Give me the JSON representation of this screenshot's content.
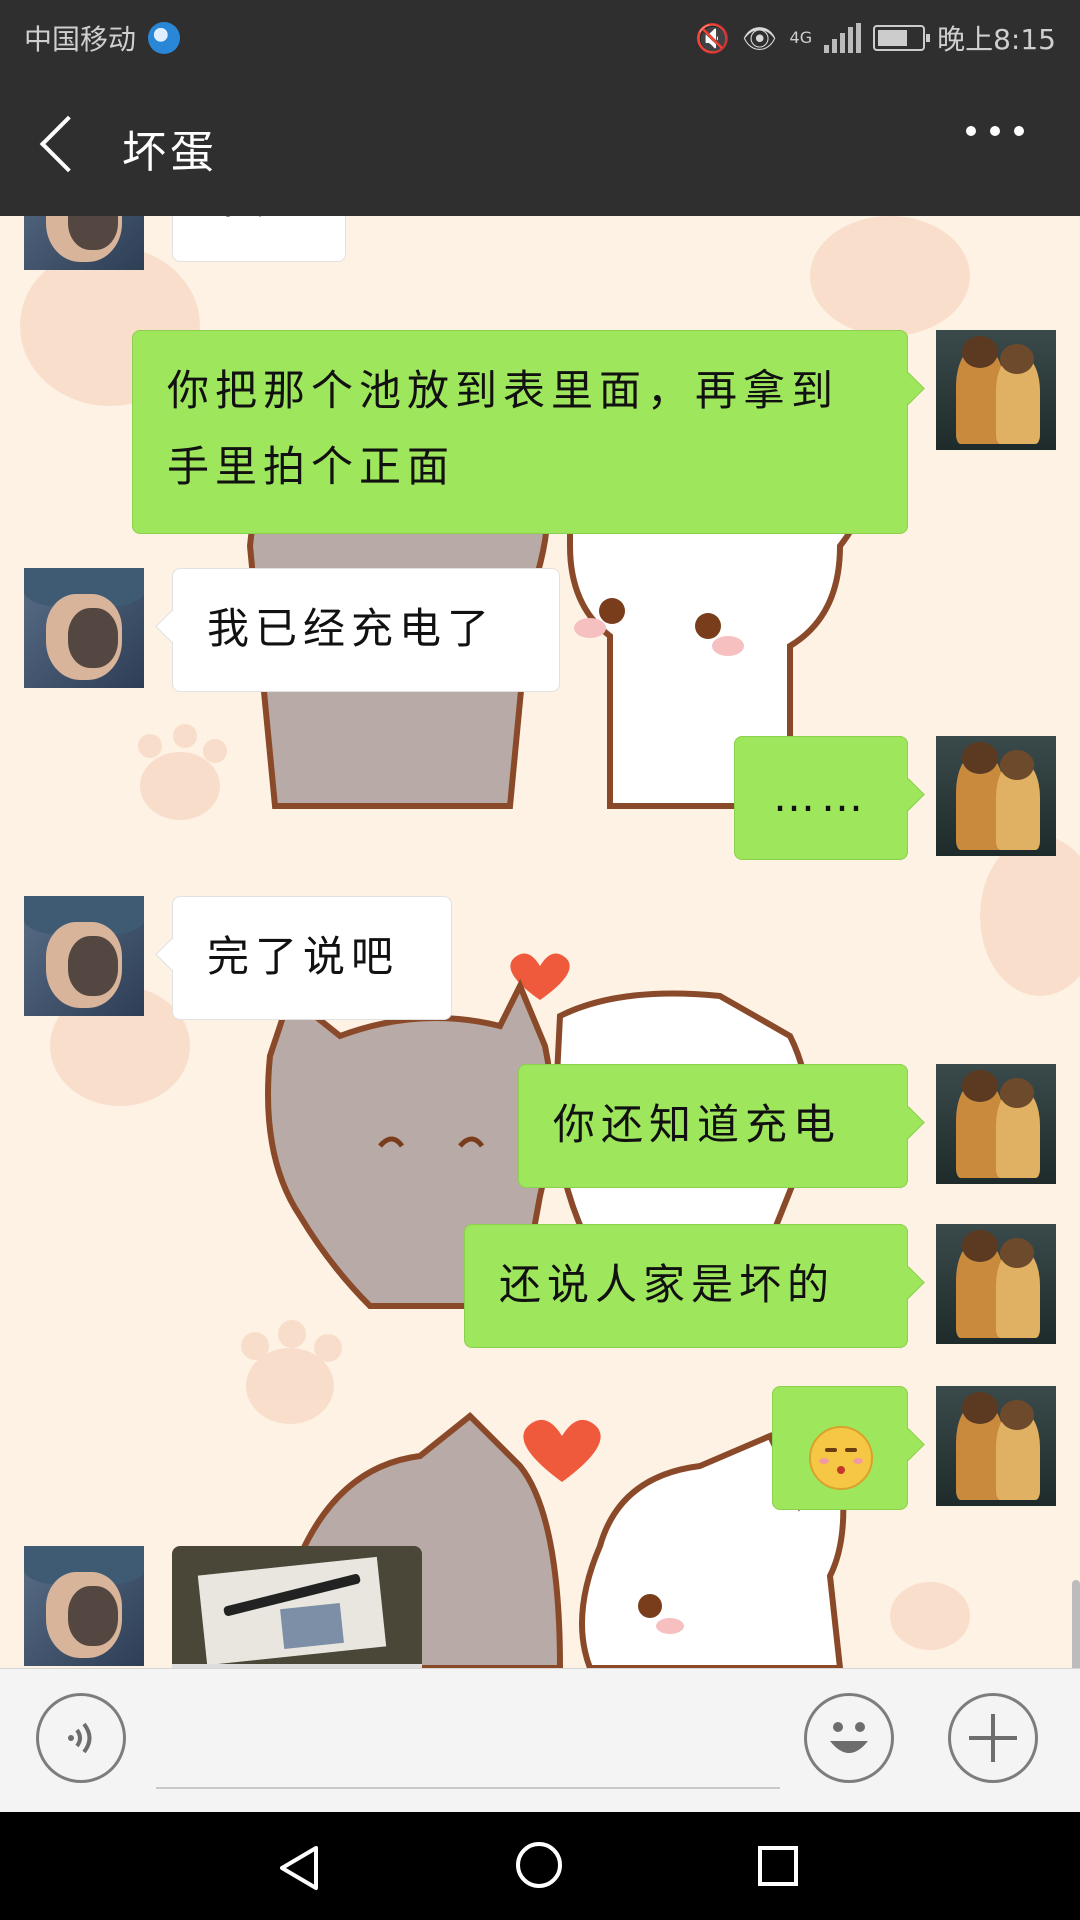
{
  "status_bar": {
    "carrier": "中国移动",
    "network": "4G",
    "time": "晚上8:15",
    "battery_level": 0.6,
    "icons": [
      "mute-icon",
      "eye-icon",
      "signal-icon",
      "battery-icon"
    ]
  },
  "header": {
    "title": "坏蛋"
  },
  "messages": [
    {
      "from": "other",
      "text": "不亮"
    },
    {
      "from": "me",
      "text": "你把那个池放到表里面，再拿到手里拍个正面"
    },
    {
      "from": "other",
      "text": "我已经充电了"
    },
    {
      "from": "me",
      "text": "……"
    },
    {
      "from": "other",
      "text": "完了说吧"
    },
    {
      "from": "me",
      "text": "你还知道充电"
    },
    {
      "from": "me",
      "text": "还说人家是坏的"
    },
    {
      "from": "me",
      "type": "emoji",
      "emoji": "blushing-kiss-emoji"
    },
    {
      "from": "other",
      "type": "photo",
      "photo": "photo-thumbnail"
    }
  ],
  "input_bar": {
    "voice_icon": "voice-icon",
    "emoji_icon": "emoji-icon",
    "plus_icon": "plus-icon"
  },
  "colors": {
    "header_bg": "#2f2f2f",
    "bubble_out": "#9ee65c",
    "bubble_in": "#ffffff",
    "chat_bg": "#fdf2e4"
  }
}
